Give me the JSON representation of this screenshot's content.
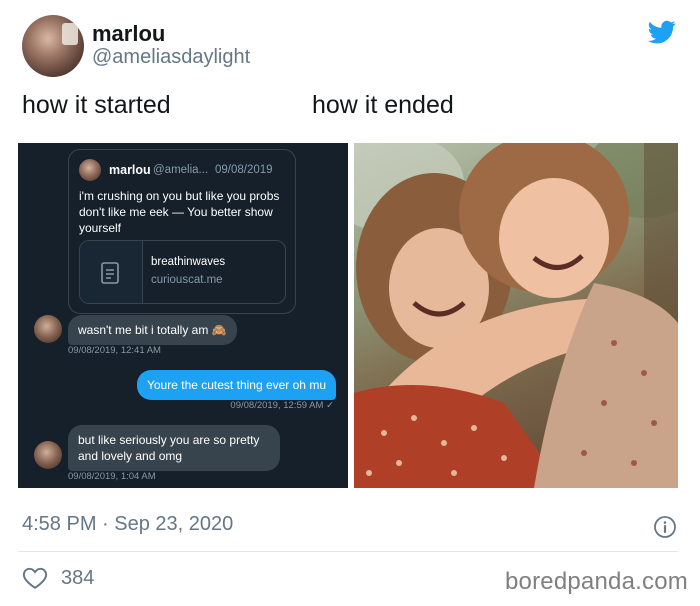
{
  "author": {
    "display_name": "marlou",
    "handle": "@ameliasdaylight"
  },
  "captions": {
    "left": "how it started",
    "right": "how it ended"
  },
  "chat": {
    "quoted_tweet": {
      "name": "marlou",
      "handle": "@amelia...",
      "date": "09/08/2019",
      "text": "i'm crushing on you but like you probs don't like me eek — You better show yourself",
      "link_card": {
        "title": "breathinwaves",
        "domain": "curiouscat.me"
      }
    },
    "messages": [
      {
        "direction": "in",
        "text": "wasn't me bit i totally am 🙈",
        "time": "09/08/2019, 12:41 AM"
      },
      {
        "direction": "out",
        "text": "Youre the cutest thing ever oh mu",
        "time": "09/08/2019, 12:59 AM ✓"
      },
      {
        "direction": "in",
        "text": "but like seriously you are so pretty and lovely and omg",
        "time": "09/08/2019, 1:04 AM"
      }
    ]
  },
  "photo": {
    "description_icon": "photo-two-women-laughing"
  },
  "footer": {
    "timestamp": "4:58 PM · Sep 23, 2020",
    "like_count": "384",
    "watermark": "boredpanda.com"
  },
  "colors": {
    "twitter_blue": "#1da1f2",
    "chat_background": "#15202b",
    "incoming_bubble": "#38444d",
    "muted_text": "#657786"
  },
  "icons": {
    "brand": "twitter-bird-icon",
    "info": "info-icon",
    "like": "heart-icon",
    "link_card": "document-icon"
  }
}
